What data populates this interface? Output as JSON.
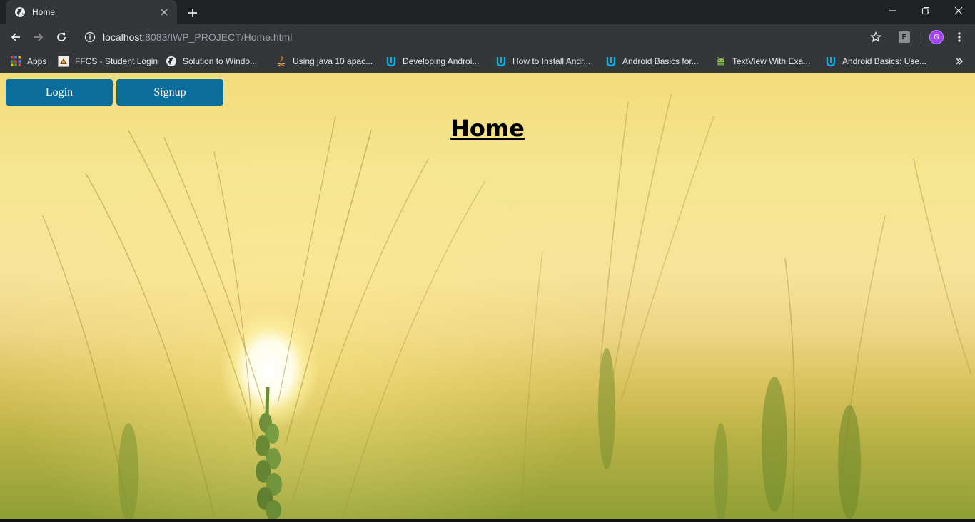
{
  "browser": {
    "tab": {
      "title": "Home",
      "favicon": "globe-icon"
    },
    "url": {
      "host": "localhost",
      "rest": ":8083/IWP_PROJECT/Home.html"
    },
    "extension_label": "E",
    "profile_initial": "G"
  },
  "bookmarks": [
    {
      "label": "Apps",
      "icon": "apps-grid-icon"
    },
    {
      "label": "FFCS - Student Login",
      "icon": "ffcs-icon"
    },
    {
      "label": "Solution to Windo...",
      "icon": "globe-icon"
    },
    {
      "label": "Using java 10 apac...",
      "icon": "java-icon"
    },
    {
      "label": "Developing Androi...",
      "icon": "udacity-icon"
    },
    {
      "label": "How to Install Andr...",
      "icon": "udacity-icon"
    },
    {
      "label": "Android Basics for...",
      "icon": "udacity-icon"
    },
    {
      "label": "TextView With Exa...",
      "icon": "android-icon"
    },
    {
      "label": "Android Basics: Use...",
      "icon": "udacity-icon"
    }
  ],
  "page": {
    "login_label": "Login",
    "signup_label": "Signup",
    "heading": "Home"
  },
  "colors": {
    "button_bg": "#0b6d99",
    "chrome_dark": "#202124",
    "chrome_toolbar": "#35363a"
  }
}
